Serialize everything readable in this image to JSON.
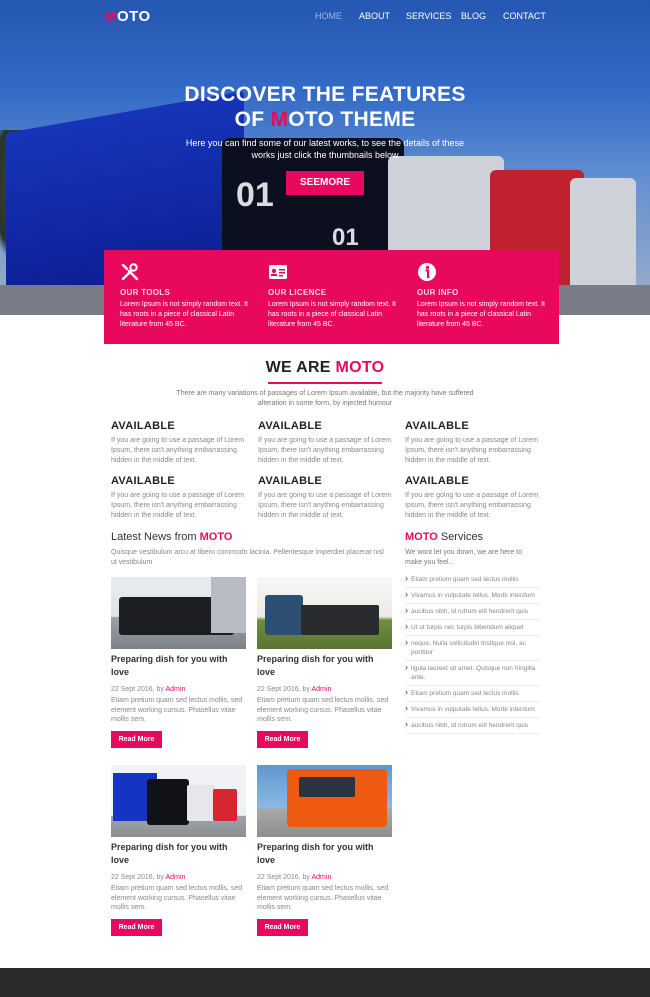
{
  "brand": {
    "logo_first": "M",
    "logo_rest": "OTO"
  },
  "nav": [
    {
      "label": "HOME",
      "active": true
    },
    {
      "label": "ABOUT",
      "active": false
    },
    {
      "label": "SERVICES",
      "active": false
    },
    {
      "label": "BLOG",
      "active": false
    },
    {
      "label": "CONTACT",
      "active": false
    }
  ],
  "hero": {
    "title_line1": "DISCOVER THE FEATURES",
    "title_line2_pre": "OF ",
    "title_line2_m": "M",
    "title_line2_post": "OTO THEME",
    "subtitle": "Here you can find some of our latest works, to see the details of these works just click the thumbnails below",
    "button": "SEEMORE",
    "truck_number": "01"
  },
  "features": [
    {
      "icon": "tools-icon",
      "title": "OUR TOOLS",
      "desc": "Lorem Ipsum is not simply random text. It has roots in a piece of classical Latin literature from 45 BC."
    },
    {
      "icon": "licence-card-icon",
      "title": "OUR LICENCE",
      "desc": "Lorem Ipsum is not simply random text. It has roots in a piece of classical Latin literature from 45 BC."
    },
    {
      "icon": "info-icon",
      "title": "OUR INFO",
      "desc": "Lorem Ipsum is not simply random text. It has roots in a piece of classical Latin literature from 45 BC."
    }
  ],
  "about": {
    "title_pre": "WE ARE ",
    "title_highlight": "MOTO",
    "desc": "There are many variations of passages of Lorem Ipsum available, but the majority have suffered alteration in some form, by injected humour"
  },
  "available": [
    {
      "title": "AVAILABLE",
      "desc": "If you are going to use a passage of Lorem Ipsum, there isn't anything embarrassing hidden in the middle of text."
    },
    {
      "title": "AVAILABLE",
      "desc": "If you are going to use a passage of Lorem Ipsum, there isn't anything embarrassing hidden in the middle of text."
    },
    {
      "title": "AVAILABLE",
      "desc": "If you are going to use a passage of Lorem Ipsum, there isn't anything embarrassing hidden in the middle of text."
    },
    {
      "title": "AVAILABLE",
      "desc": "If you are going to use a passage of Lorem Ipsum, there isn't anything embarrassing hidden in the middle of text."
    },
    {
      "title": "AVAILABLE",
      "desc": "If you are going to use a passage of Lorem Ipsum, there isn't anything embarrassing hidden in the middle of text."
    },
    {
      "title": "AVAILABLE",
      "desc": "If you are going to use a passage of Lorem Ipsum, there isn't anything embarrassing hidden in the middle of text."
    }
  ],
  "news": {
    "heading_pre": "Latest News from ",
    "heading_highlight": "MOTO",
    "sub": "Quisque vestibulum arcu at libero commodo lacinia. Pellentesque imperdiet placerat nisl ut vestibulum",
    "posts": [
      {
        "title": "Preparing dish for you with love",
        "date": "22 Sept 2016, by ",
        "author": "Admin",
        "desc": "Etiam pretium quam sed lectus mollis, sed element working cursus. Phasellus vitae mollis sem.",
        "button": "Read More"
      },
      {
        "title": "Preparing dish for you with love",
        "date": "22 Sept 2016, by ",
        "author": "Admin",
        "desc": "Etiam pretium quam sed lectus mollis, sed element working cursus. Phasellus vitae mollis sem.",
        "button": "Read More"
      },
      {
        "title": "Preparing dish for you with love",
        "date": "22 Sept 2016, by ",
        "author": "Admin",
        "desc": "Etiam pretium quam sed lectus mollis, sed element working cursus. Phasellus vitae mollis sem.",
        "button": "Read More"
      },
      {
        "title": "Preparing dish for you with love",
        "date": "22 Sept 2016, by ",
        "author": "Admin",
        "desc": "Etiam pretium quam sed lectus mollis, sed element working cursus. Phasellus vitae mollis sem.",
        "button": "Read More"
      }
    ]
  },
  "services": {
    "heading_highlight": "MOTO",
    "heading_post": " Services",
    "sub": "We wont let you down, we are here to make you feel..",
    "items": [
      "Etiam pretium quam sed lectus mollis",
      "Vivamus in vulputate tellus. Morbi interdum",
      "aucibus nibh, id rutrum elit hendrerit quis",
      "Ut ut turpis nec turpis bibendum aliquet",
      "neque. Nulla sollicitudin tristique nisl, ac porttitor",
      "ligula laoreet sit amet. Quisque non fringilla ante.",
      "Etiam pretium quam sed lectus mollis",
      "Vivamus in vulputate tellus. Morbi interdum",
      "aucibus nibh, id rutrum elit hendrerit quis"
    ]
  },
  "colors": {
    "accent": "#e8095f",
    "footer": "#2b2b2b"
  }
}
